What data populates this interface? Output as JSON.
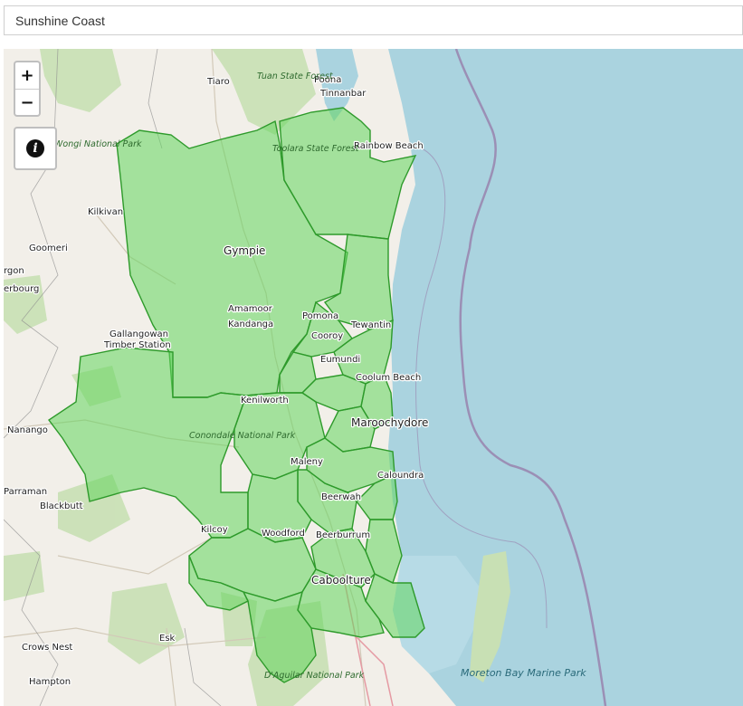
{
  "search": {
    "value": "Sunshine Coast"
  },
  "controls": {
    "zoom_in": "+",
    "zoom_out": "−",
    "info": "i"
  },
  "colors": {
    "land": "#f2efe9",
    "water": "#aad3df",
    "region_fill": "#63d65c",
    "region_stroke": "#2e9a2b",
    "forest": "#c8e0b4",
    "boundary": "#9b8fb5"
  },
  "places": [
    {
      "name": "Tiaro"
    },
    {
      "name": "Poona"
    },
    {
      "name": "Tinnanbar"
    },
    {
      "name": "Rainbow Beach"
    },
    {
      "name": "Kilkivan"
    },
    {
      "name": "Goomeri"
    },
    {
      "name": "rgon"
    },
    {
      "name": "erbourg"
    },
    {
      "name": "Gympie"
    },
    {
      "name": "Amamoor"
    },
    {
      "name": "Kandanga"
    },
    {
      "name": "Pomona"
    },
    {
      "name": "Cooroy"
    },
    {
      "name": "Tewantin"
    },
    {
      "name": "Eumundi"
    },
    {
      "name": "Coolum Beach"
    },
    {
      "name": "Gallangowan"
    },
    {
      "name": "Timber Station"
    },
    {
      "name": "Kenilworth"
    },
    {
      "name": "Maroochydore"
    },
    {
      "name": "Nanango"
    },
    {
      "name": "Maleny"
    },
    {
      "name": "Caloundra"
    },
    {
      "name": "Parraman"
    },
    {
      "name": "Blackbutt"
    },
    {
      "name": "Beerwah"
    },
    {
      "name": "Kilcoy"
    },
    {
      "name": "Woodford"
    },
    {
      "name": "Beerburrum"
    },
    {
      "name": "Caboolture"
    },
    {
      "name": "Crows Nest"
    },
    {
      "name": "Esk"
    },
    {
      "name": "Hampton"
    }
  ],
  "parks": [
    {
      "name": "Tuan State Forest"
    },
    {
      "name": "Wongi National Park"
    },
    {
      "name": "Toolara State Forest"
    },
    {
      "name": "Conondale National Park"
    },
    {
      "name": "D'Aguilar National Park"
    },
    {
      "name": "Moreton Bay Marine Park"
    }
  ]
}
